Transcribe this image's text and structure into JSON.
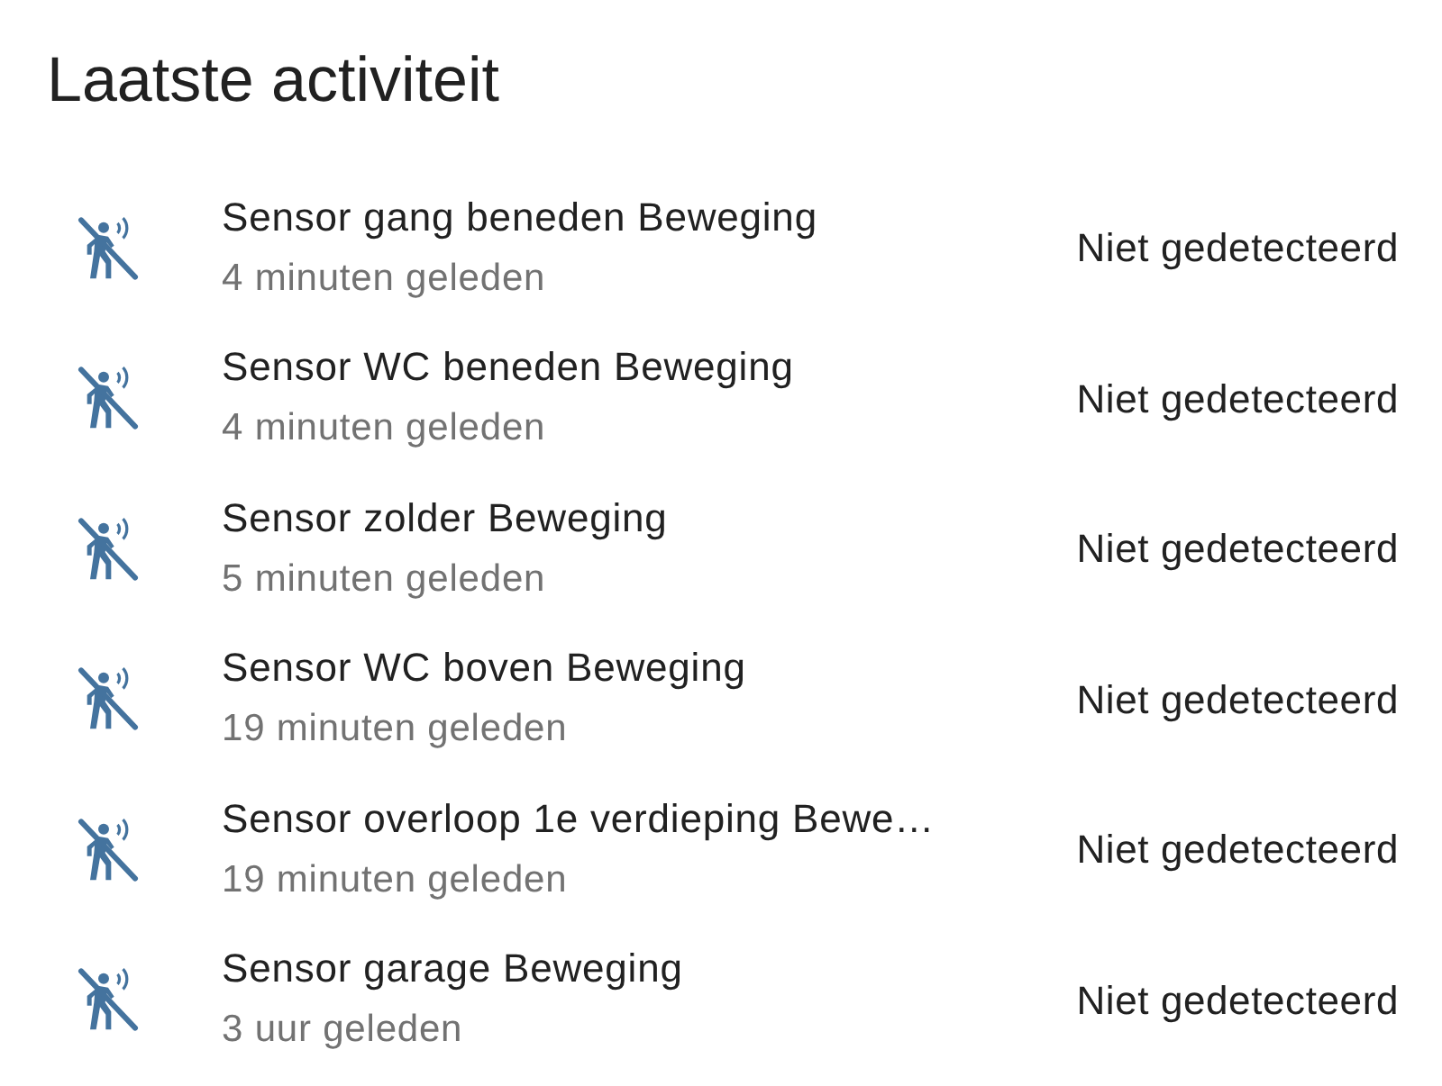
{
  "title": "Laatste activiteit",
  "entries": [
    {
      "name": "Sensor gang beneden Beweging",
      "time": "4 minuten geleden",
      "state": "Niet gedetecteerd"
    },
    {
      "name": "Sensor WC beneden Beweging",
      "time": "4 minuten geleden",
      "state": "Niet gedetecteerd"
    },
    {
      "name": "Sensor zolder Beweging",
      "time": "5 minuten geleden",
      "state": "Niet gedetecteerd"
    },
    {
      "name": "Sensor WC boven Beweging",
      "time": "19 minuten geleden",
      "state": "Niet gedetecteerd"
    },
    {
      "name": "Sensor overloop 1e verdieping Bewe…",
      "time": "19 minuten geleden",
      "state": "Niet gedetecteerd"
    },
    {
      "name": "Sensor garage Beweging",
      "time": "3 uur geleden",
      "state": "Niet gedetecteerd"
    }
  ]
}
